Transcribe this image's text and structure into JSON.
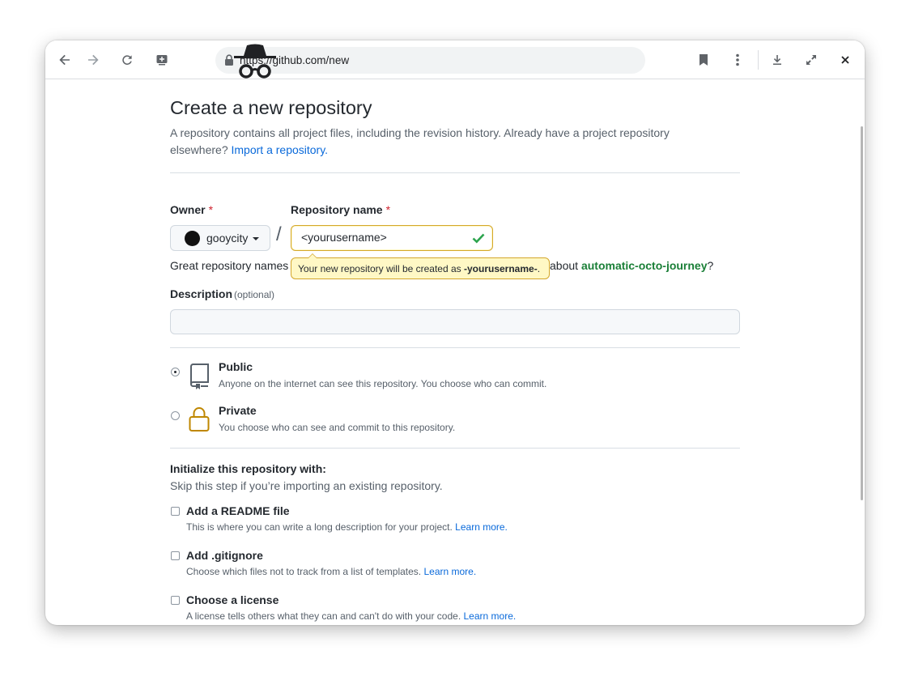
{
  "browser": {
    "url": "https://github.com/new",
    "icons": [
      "back-arrow-icon",
      "forward-arrow-icon",
      "reload-icon",
      "add-to-app-icon",
      "lock-icon",
      "incognito-icon",
      "bookmark-icon",
      "more-vert-icon",
      "download-icon",
      "fullscreen-icon",
      "close-icon"
    ]
  },
  "page": {
    "title": "Create a new repository",
    "subtitle": "A repository contains all project files, including the revision history. Already have a project repository elsewhere?",
    "import_link": "Import a repository."
  },
  "owner": {
    "label": "Owner",
    "required_mark": "*",
    "value": "gooycity"
  },
  "repo_name": {
    "label": "Repository name",
    "required_mark": "*",
    "value": "<yourusername>",
    "tooltip_prefix": "Your new repository will be created as ",
    "tooltip_name": "-yourusername-",
    "tooltip_suffix": "."
  },
  "hint": {
    "prefix": "Great repository names",
    "about": "about",
    "suggestion": "automatic-octo-journey",
    "suffix": "?"
  },
  "description": {
    "label": "Description",
    "optional": "(optional)",
    "value": ""
  },
  "visibility": {
    "selected": "Public",
    "options": [
      {
        "title": "Public",
        "desc": "Anyone on the internet can see this repository. You choose who can commit."
      },
      {
        "title": "Private",
        "desc": "You choose who can see and commit to this repository."
      }
    ]
  },
  "initialize": {
    "heading": "Initialize this repository with:",
    "subheading": "Skip this step if you’re importing an existing repository.",
    "options": [
      {
        "title": "Add a README file",
        "desc": "This is where you can write a long description for your project.",
        "link": "Learn more."
      },
      {
        "title": "Add .gitignore",
        "desc": "Choose which files not to track from a list of templates.",
        "link": "Learn more."
      },
      {
        "title": "Choose a license",
        "desc": "A license tells others what they can and can't do with your code.",
        "link": "Learn more."
      }
    ]
  },
  "colors": {
    "link": "#0969da",
    "required": "#cf222e",
    "success": "#1a7f37",
    "warning_bg": "#fff8c5",
    "warning_border": "#d4a72c",
    "private_lock": "#bf8700"
  }
}
